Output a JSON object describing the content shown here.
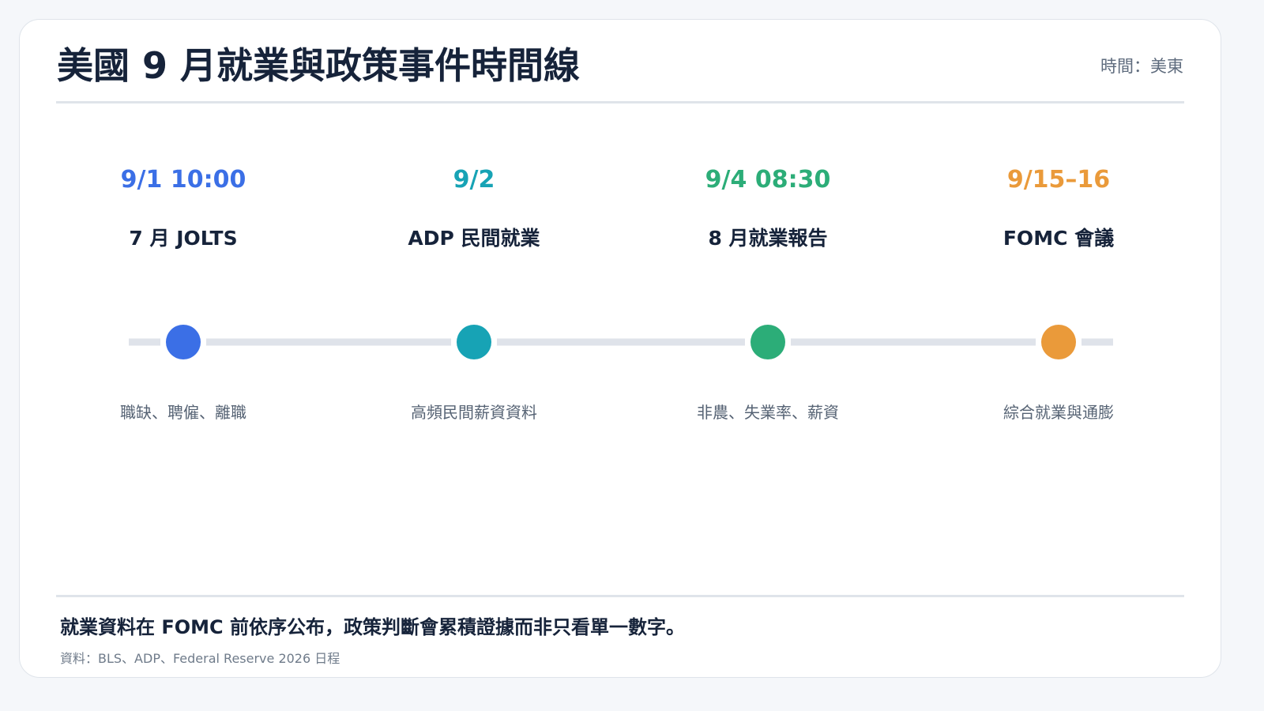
{
  "header": {
    "title": "美國 9 月就業與政策事件時間線",
    "timezone": "時間：美東"
  },
  "timeline": {
    "events": [
      {
        "date": "9/1 10:00",
        "name": "7 月 JOLTS",
        "detail": "職缺、聘僱、離職",
        "color": "#3b6fe6"
      },
      {
        "date": "9/2",
        "name": "ADP 民間就業",
        "detail": "高頻民間薪資資料",
        "color": "#17a3b5"
      },
      {
        "date": "9/4 08:30",
        "name": "8 月就業報告",
        "detail": "非農、失業率、薪資",
        "color": "#2cad78"
      },
      {
        "date": "9/15–16",
        "name": "FOMC 會議",
        "detail": "綜合就業與通膨",
        "color": "#ea9a3a"
      }
    ],
    "track_color": "#dfe3ea"
  },
  "footer": {
    "takeaway": "就業資料在 FOMC 前依序公布，政策判斷會累積證據而非只看單一數字。",
    "source": "資料：BLS、ADP、Federal Reserve 2026 日程"
  }
}
